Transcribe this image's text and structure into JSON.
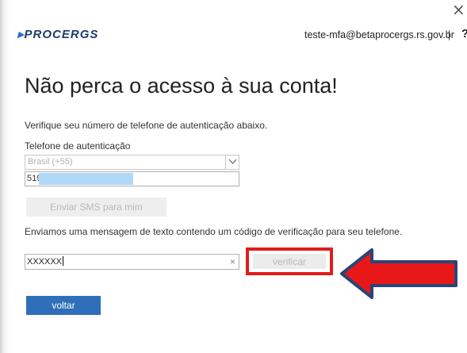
{
  "window": {
    "close_glyph": "×"
  },
  "header": {
    "logo_text": "PROCERGS",
    "email": "teste-mfa@betaprocergs.rs.gov.br",
    "separator": "|",
    "help_glyph": "?"
  },
  "main": {
    "title": "Não perca o acesso à sua conta!",
    "instruction": "Verifique seu número de telefone de autenticação abaixo.",
    "phone_label": "Telefone de autenticação",
    "country_selected": "Brasil (+55)",
    "phone_prefix": "519",
    "sms_button_label": "Enviar SMS para mim",
    "sent_message": "Enviamos uma mensagem de texto contendo um código de verificação para seu telefone.",
    "code_value": "XXXXXX",
    "clear_glyph": "×",
    "verify_button_label": "verificar",
    "back_button_label": "voltar"
  },
  "colors": {
    "highlight_border": "#e31b1b",
    "arrow_fill": "#e81818",
    "primary_button": "#2f6fba",
    "redaction": "#aed8f5"
  },
  "icons": [
    "close-icon",
    "chevron-down-icon",
    "clear-icon",
    "red-arrow-annotation"
  ]
}
